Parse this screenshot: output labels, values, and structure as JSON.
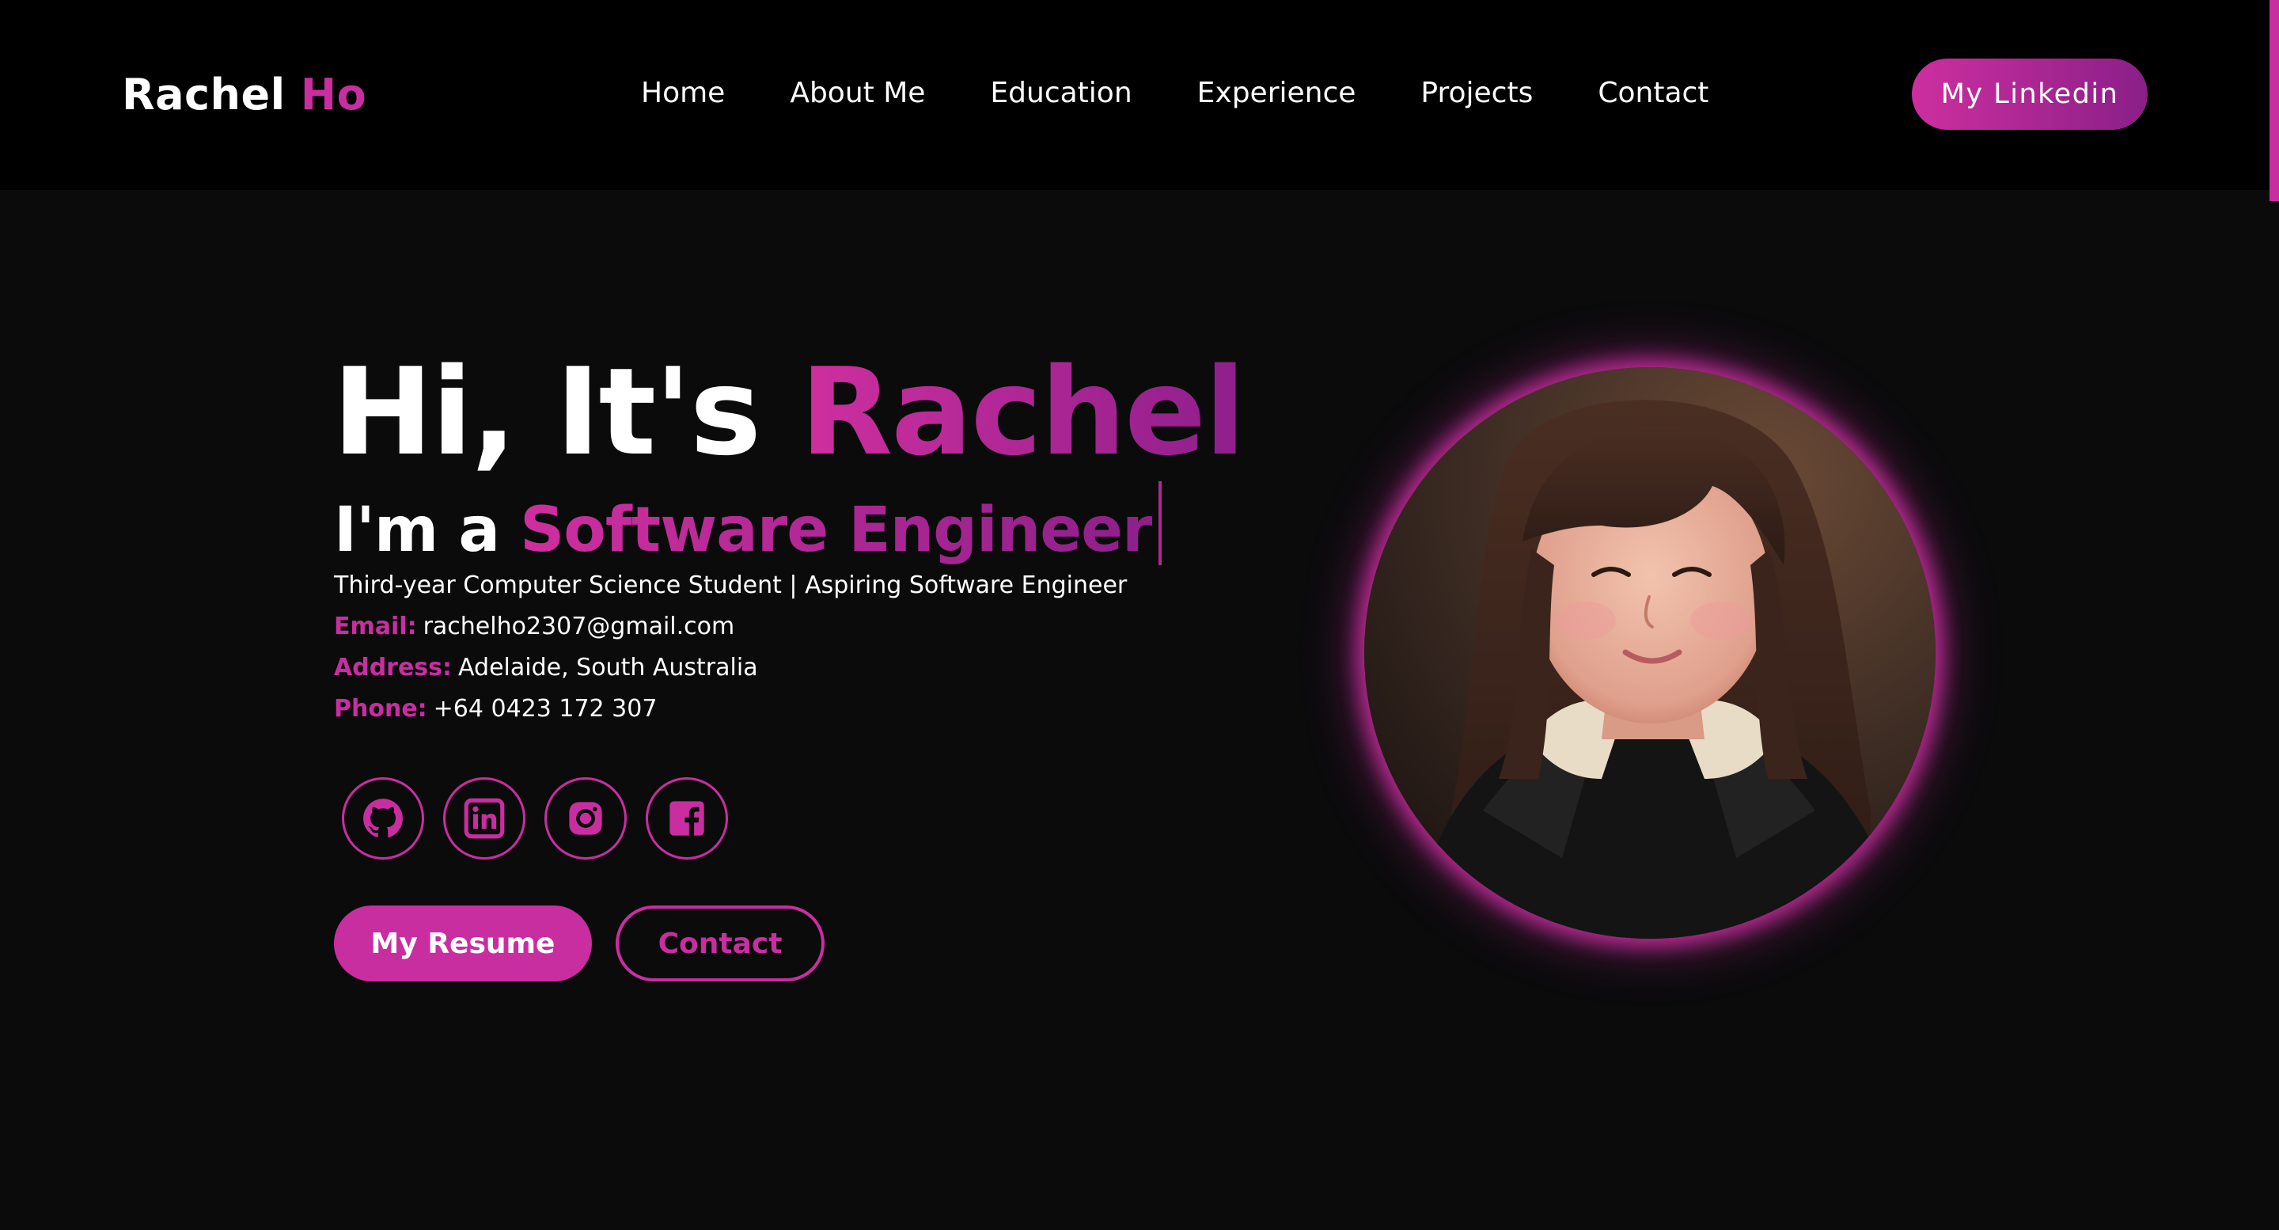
{
  "header": {
    "logo_first": "Rachel",
    "logo_last": "Ho",
    "nav": [
      "Home",
      "About Me",
      "Education",
      "Experience",
      "Projects",
      "Contact"
    ],
    "cta": "My Linkedin"
  },
  "hero": {
    "greeting": "Hi, It's",
    "name": "Rachel",
    "role_prefix": "I'm a",
    "role": "Software Engineer",
    "tagline": "Third-year Computer Science Student | Aspiring Software Engineer",
    "email_label": "Email:",
    "email": "rachelho2307@gmail.com",
    "address_label": "Address:",
    "address": "Adelaide, South Australia",
    "phone_label": "Phone:",
    "phone": "+64 0423 172 307",
    "socials": [
      "github-icon",
      "linkedin-icon",
      "instagram-icon",
      "facebook-icon"
    ],
    "resume_button": "My Resume",
    "contact_button": "Contact"
  },
  "colors": {
    "accent": "#c92ea0",
    "accent_dark": "#8a1f88",
    "background": "#0b0b0c",
    "header": "#000000"
  }
}
